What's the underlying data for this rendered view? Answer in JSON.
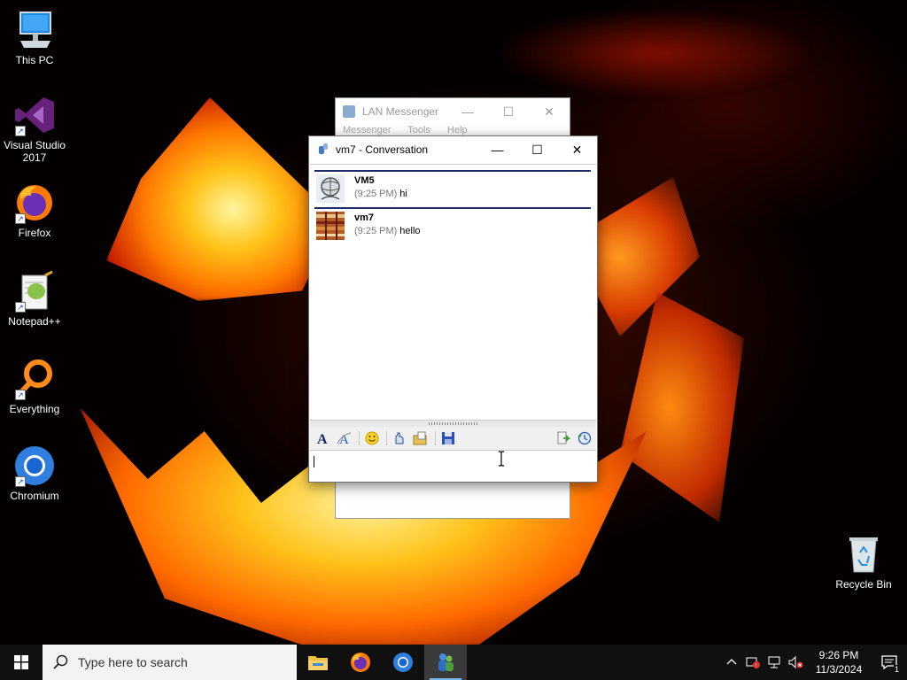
{
  "desktop": {
    "icons": [
      {
        "label": "This PC",
        "icon": "computer-icon"
      },
      {
        "label": "Visual Studio 2017",
        "icon": "visual-studio-icon"
      },
      {
        "label": "Firefox",
        "icon": "firefox-icon"
      },
      {
        "label": "Notepad++",
        "icon": "notepad-plus-plus-icon"
      },
      {
        "label": "Everything",
        "icon": "everything-search-icon"
      },
      {
        "label": "Chromium",
        "icon": "chromium-icon"
      },
      {
        "label": "Recycle Bin",
        "icon": "recycle-bin-icon"
      }
    ]
  },
  "lan_window": {
    "title": "LAN Messenger",
    "menu": [
      "Messenger",
      "Tools",
      "Help"
    ]
  },
  "conversation": {
    "title": "vm7 - Conversation",
    "messages": [
      {
        "sender": "VM5",
        "time": "(9:25 PM)",
        "text": "hi"
      },
      {
        "sender": "vm7",
        "time": "(9:25 PM)",
        "text": "hello"
      }
    ],
    "input_value": ""
  },
  "taskbar": {
    "search_placeholder": "Type here to search",
    "clock_time": "9:26 PM",
    "clock_date": "11/3/2024",
    "notification_count": "1"
  },
  "colors": {
    "message_separator": "#1f2a66",
    "taskbar_bg": "#101010",
    "running_indicator": "#76b9ed"
  }
}
